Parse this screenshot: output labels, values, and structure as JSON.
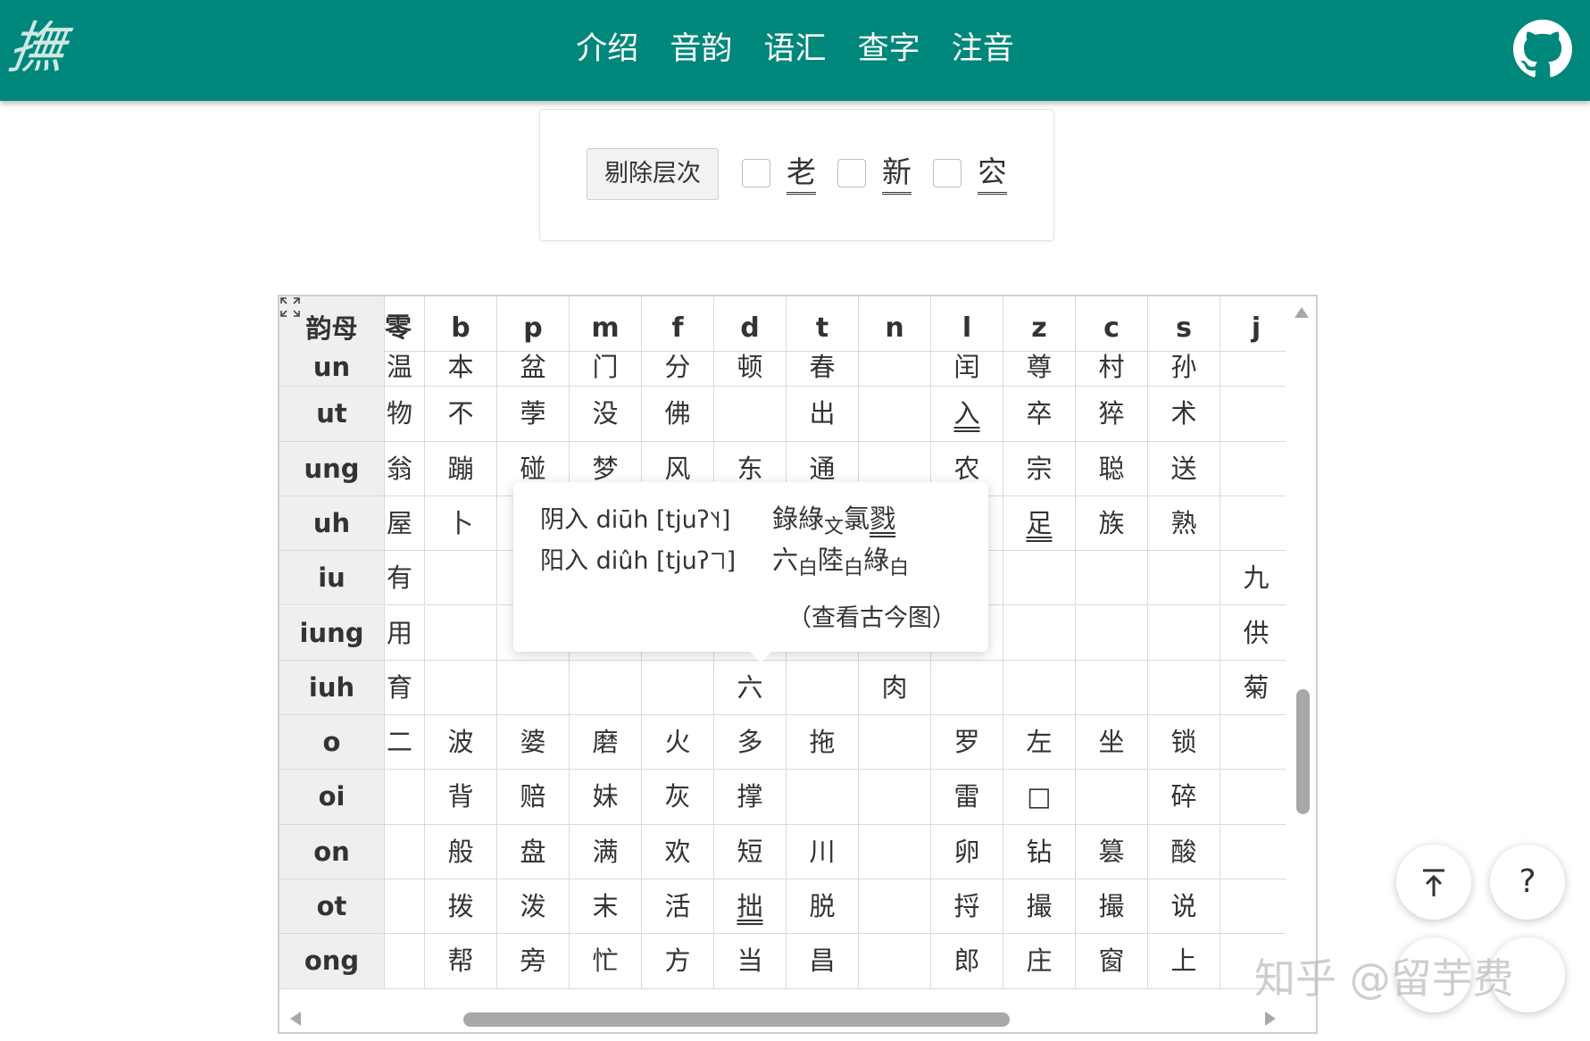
{
  "brand": {
    "logo_text": "撫"
  },
  "nav": {
    "items": [
      "介绍",
      "音韵",
      "语汇",
      "查字",
      "注音"
    ]
  },
  "options": {
    "strip_button": "剔除层次",
    "checkboxes": [
      {
        "label": "老",
        "checked": false
      },
      {
        "label": "新",
        "checked": false
      },
      {
        "label": "㝐",
        "checked": false
      }
    ]
  },
  "table": {
    "corner_label": "韵母",
    "columns": [
      "零",
      "b",
      "p",
      "m",
      "f",
      "d",
      "t",
      "n",
      "l",
      "z",
      "c",
      "s",
      "j"
    ],
    "rows": [
      {
        "final": "un",
        "cells": [
          "温",
          "本",
          "盆",
          "门",
          "分",
          "顿",
          "春",
          "",
          "闰",
          "尊",
          "村",
          "孙",
          ""
        ]
      },
      {
        "final": "ut",
        "cells": [
          "物",
          "不",
          "荸",
          "没",
          "佛",
          "",
          "出",
          "",
          "入",
          "卒",
          "猝",
          "术",
          ""
        ]
      },
      {
        "final": "ung",
        "cells": [
          "翁",
          "蹦",
          "碰",
          "梦",
          "风",
          "东",
          "通",
          "",
          "农",
          "宗",
          "聪",
          "送",
          ""
        ]
      },
      {
        "final": "uh",
        "cells": [
          "屋",
          "卜",
          "",
          "",
          "",
          "",
          "",
          "",
          "",
          "足",
          "族",
          "熟",
          ""
        ]
      },
      {
        "final": "iu",
        "cells": [
          "有",
          "",
          "",
          "",
          "",
          "",
          "",
          "",
          "",
          "",
          "",
          "",
          "九"
        ]
      },
      {
        "final": "iung",
        "cells": [
          "用",
          "",
          "",
          "",
          "",
          "",
          "",
          "",
          "",
          "",
          "",
          "",
          "供"
        ]
      },
      {
        "final": "iuh",
        "cells": [
          "育",
          "",
          "",
          "",
          "",
          "六",
          "",
          "肉",
          "",
          "",
          "",
          "",
          "菊"
        ]
      },
      {
        "final": "o",
        "cells": [
          "二",
          "波",
          "婆",
          "磨",
          "火",
          "多",
          "拖",
          "",
          "罗",
          "左",
          "坐",
          "锁",
          ""
        ]
      },
      {
        "final": "oi",
        "cells": [
          "",
          "背",
          "赔",
          "妹",
          "灰",
          "撑",
          "",
          "",
          "雷",
          "□",
          "",
          "碎",
          ""
        ]
      },
      {
        "final": "on",
        "cells": [
          "",
          "般",
          "盘",
          "满",
          "欢",
          "短",
          "川",
          "",
          "卵",
          "钻",
          "篡",
          "酸",
          ""
        ]
      },
      {
        "final": "ot",
        "cells": [
          "",
          "拨",
          "泼",
          "末",
          "活",
          "拙",
          "脱",
          "",
          "捋",
          "撮",
          "撮",
          "说",
          ""
        ]
      },
      {
        "final": "ong",
        "cells": [
          "",
          "帮",
          "旁",
          "忙",
          "方",
          "当",
          "昌",
          "",
          "郎",
          "庄",
          "窗",
          "上",
          ""
        ]
      }
    ]
  },
  "tooltip": {
    "line1_reading": "阴入 diūh [tjuʔ˥˧]",
    "line1_chars": [
      "錄",
      "綠",
      "文",
      "氯",
      "戮"
    ],
    "line2_reading": "阳入 diûh [tjuʔ˥˥]",
    "line2_chars": [
      "六",
      "白",
      "陸",
      "白",
      "綠",
      "白"
    ],
    "link": "（查看古今图）"
  },
  "fabs": {
    "top": "⤒",
    "help": "?"
  },
  "watermark": "知乎 @留芋费"
}
